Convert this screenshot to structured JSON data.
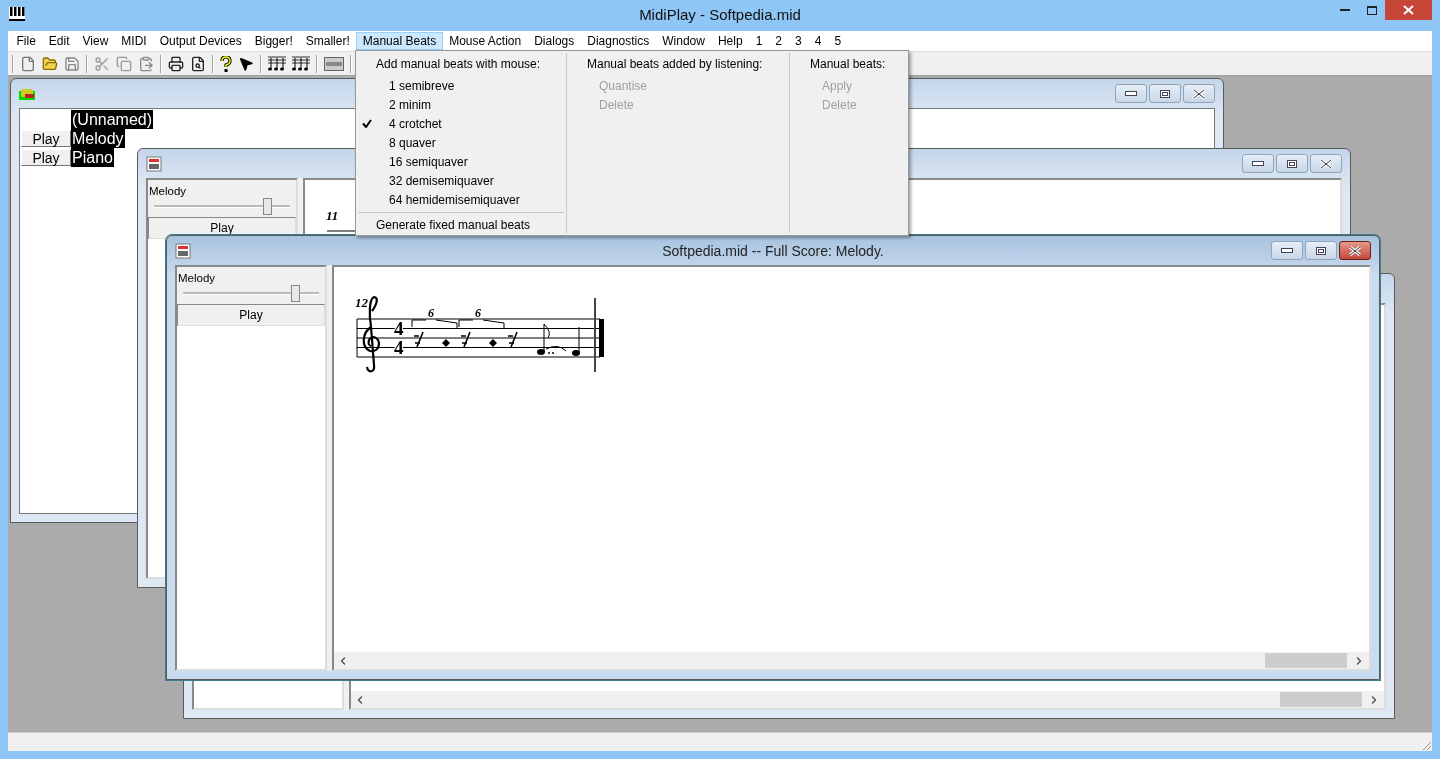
{
  "app_window": {
    "title": "MidiPlay - Softpedia.mid"
  },
  "menu_bar": [
    {
      "label": "File",
      "selected": false
    },
    {
      "label": "Edit",
      "selected": false
    },
    {
      "label": "View",
      "selected": false
    },
    {
      "label": "MIDI",
      "selected": false
    },
    {
      "label": "Output Devices",
      "selected": false
    },
    {
      "label": "Bigger!",
      "selected": false
    },
    {
      "label": "Smaller!",
      "selected": false
    },
    {
      "label": "Manual Beats",
      "selected": true
    },
    {
      "label": "Mouse Action",
      "selected": false
    },
    {
      "label": "Dialogs",
      "selected": false
    },
    {
      "label": "Diagnostics",
      "selected": false
    },
    {
      "label": "Window",
      "selected": false
    },
    {
      "label": "Help",
      "selected": false
    },
    {
      "label": "1",
      "selected": false
    },
    {
      "label": "2",
      "selected": false
    },
    {
      "label": "3",
      "selected": false
    },
    {
      "label": "4",
      "selected": false
    },
    {
      "label": "5",
      "selected": false
    }
  ],
  "dropdown": {
    "columns": [
      {
        "heading": "Add manual beats with mouse:",
        "items": [
          {
            "label": "1 semibreve",
            "checked": false,
            "disabled": false
          },
          {
            "label": "2 minim",
            "checked": false,
            "disabled": false
          },
          {
            "label": "4 crotchet",
            "checked": true,
            "disabled": false
          },
          {
            "label": "8 quaver",
            "checked": false,
            "disabled": false
          },
          {
            "label": "16 semiquaver",
            "checked": false,
            "disabled": false
          },
          {
            "label": "32 demisemiquaver",
            "checked": false,
            "disabled": false
          },
          {
            "label": "64 hemidemisemiquaver",
            "checked": false,
            "disabled": false
          }
        ],
        "footer_item": "Generate fixed manual beats"
      },
      {
        "heading": "Manual beats added by listening:",
        "items": [
          {
            "label": "Quantise",
            "checked": false,
            "disabled": true
          },
          {
            "label": "Delete",
            "checked": false,
            "disabled": true
          }
        ]
      },
      {
        "heading": "Manual beats:",
        "items": [
          {
            "label": "Apply",
            "checked": false,
            "disabled": true
          },
          {
            "label": "Delete",
            "checked": false,
            "disabled": true
          }
        ]
      }
    ]
  },
  "child_windows": [
    {
      "kind": "tracks",
      "active": false,
      "rows": [
        {
          "name": "(Unnamed)"
        },
        {
          "button": "Play",
          "name": "Melody"
        },
        {
          "button": "Play",
          "name": "Piano"
        }
      ]
    },
    {
      "kind": "score",
      "active": false,
      "track_label": "Melody",
      "level": 0.83,
      "play_button": "Play",
      "measure_number": "11"
    },
    {
      "kind": "score",
      "active": false
    },
    {
      "kind": "score",
      "active": true,
      "title": "Softpedia.mid -- Full Score: Melody.",
      "track_label": "Melody",
      "level": 0.82,
      "play_button": "Play",
      "measure_number": "12",
      "time_signature": [
        "4",
        "4"
      ],
      "tuplets": [
        "6",
        "6"
      ]
    }
  ]
}
